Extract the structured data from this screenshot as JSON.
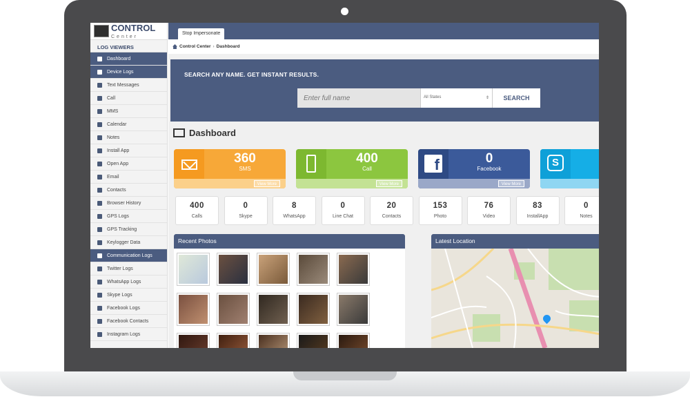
{
  "brand": {
    "name": "CONTROL",
    "sub": "Center"
  },
  "sidebar": {
    "section_title": "LOG VIEWERS",
    "items": [
      {
        "label": "Dashboard",
        "icon": "home-icon",
        "style": "dark"
      },
      {
        "label": "Device Logs",
        "icon": "list-icon",
        "style": "dark"
      },
      {
        "label": "Text Messages",
        "icon": "message-icon"
      },
      {
        "label": "Call",
        "icon": "phone-icon"
      },
      {
        "label": "MMS",
        "icon": "mms-icon"
      },
      {
        "label": "Calendar",
        "icon": "calendar-icon"
      },
      {
        "label": "Notes",
        "icon": "notes-icon"
      },
      {
        "label": "Install App",
        "icon": "install-icon"
      },
      {
        "label": "Open App",
        "icon": "open-app-icon"
      },
      {
        "label": "Email",
        "icon": "email-icon"
      },
      {
        "label": "Contacts",
        "icon": "contacts-icon"
      },
      {
        "label": "Browser History",
        "icon": "browser-icon"
      },
      {
        "label": "GPS Logs",
        "icon": "gps-icon"
      },
      {
        "label": "GPS Tracking",
        "icon": "tracking-icon"
      },
      {
        "label": "Keylogger Data",
        "icon": "keyboard-icon"
      },
      {
        "label": "Communication Logs",
        "icon": "chat-icon",
        "style": "dark"
      },
      {
        "label": "Twitter Logs",
        "icon": "twitter-icon"
      },
      {
        "label": "WhatsApp Logs",
        "icon": "whatsapp-icon"
      },
      {
        "label": "Skype Logs",
        "icon": "skype-icon"
      },
      {
        "label": "Facebook Logs",
        "icon": "facebook-icon"
      },
      {
        "label": "Facebook Contacts",
        "icon": "facebook-icon"
      },
      {
        "label": "Instagram Logs",
        "icon": "instagram-icon"
      }
    ]
  },
  "topbar": {
    "stop_label": "Stop Impersonate"
  },
  "breadcrumb": {
    "root": "Control Center",
    "sep": "›",
    "current": "Dashboard"
  },
  "search": {
    "title": "SEARCH ANY NAME. GET INSTANT RESULTS.",
    "placeholder": "Enter full name",
    "state_value": "All States",
    "button_label": "SEARCH"
  },
  "dashboard": {
    "title": "Dashboard"
  },
  "cards": [
    {
      "value": "360",
      "label": "SMS",
      "link": "View More",
      "icon": "envelope-icon"
    },
    {
      "value": "400",
      "label": "Call",
      "link": "View More",
      "icon": "mobile-icon"
    },
    {
      "value": "0",
      "label": "Facebook",
      "link": "View More",
      "icon": "facebook-icon"
    },
    {
      "icon": "skype-icon"
    }
  ],
  "stats": [
    {
      "value": "400",
      "label": "Calls"
    },
    {
      "value": "0",
      "label": "Skype"
    },
    {
      "value": "8",
      "label": "WhatsApp"
    },
    {
      "value": "0",
      "label": "Line Chat"
    },
    {
      "value": "20",
      "label": "Contacts"
    },
    {
      "value": "153",
      "label": "Photo"
    },
    {
      "value": "76",
      "label": "Video"
    },
    {
      "value": "83",
      "label": "InstallApp"
    },
    {
      "value": "0",
      "label": "Notes"
    }
  ],
  "photos_panel": {
    "title": "Recent Photos"
  },
  "map_panel": {
    "title": "Latest Location"
  },
  "colors": {
    "accent": "#4b5c80",
    "sms": "#f7a838",
    "call": "#8cc63f",
    "facebook": "#3b5a9a",
    "skype": "#15aee6"
  }
}
